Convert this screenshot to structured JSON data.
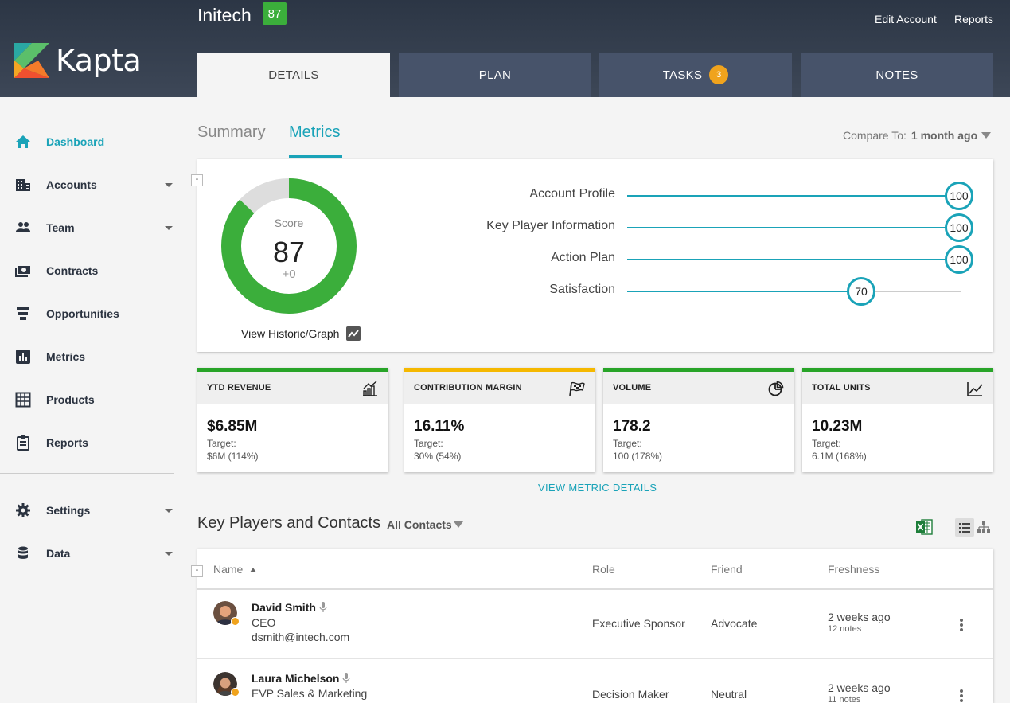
{
  "header": {
    "account_name": "Initech",
    "account_score": "87",
    "logo_text": "Kapta",
    "links": [
      "Edit Account",
      "Reports"
    ],
    "tabs": [
      {
        "label": "DETAILS",
        "badge": null
      },
      {
        "label": "PLAN",
        "badge": null
      },
      {
        "label": "TASKS",
        "badge": "3"
      },
      {
        "label": "NOTES",
        "badge": null
      }
    ],
    "active_tab": "DETAILS"
  },
  "sidebar": {
    "items": [
      {
        "label": "Dashboard",
        "icon": "home-icon",
        "active": true,
        "has_submenu": false
      },
      {
        "label": "Accounts",
        "icon": "building-icon",
        "active": false,
        "has_submenu": true
      },
      {
        "label": "Team",
        "icon": "people-icon",
        "active": false,
        "has_submenu": true
      },
      {
        "label": "Contracts",
        "icon": "money-icon",
        "active": false,
        "has_submenu": false
      },
      {
        "label": "Opportunities",
        "icon": "funnel-icon",
        "active": false,
        "has_submenu": false
      },
      {
        "label": "Metrics",
        "icon": "bar-chart-icon",
        "active": false,
        "has_submenu": false
      },
      {
        "label": "Products",
        "icon": "grid-icon",
        "active": false,
        "has_submenu": false
      },
      {
        "label": "Reports",
        "icon": "clipboard-icon",
        "active": false,
        "has_submenu": false
      },
      {
        "label": "Settings",
        "icon": "gear-icon",
        "active": false,
        "has_submenu": true
      },
      {
        "label": "Data",
        "icon": "database-icon",
        "active": false,
        "has_submenu": true
      }
    ]
  },
  "subtabs": {
    "items": [
      "Summary",
      "Metrics"
    ],
    "active": "Metrics",
    "compare_label": "Compare To:",
    "compare_value": "1 month ago"
  },
  "score_card": {
    "collapse_label": "-",
    "score_label": "Score",
    "score": "87",
    "score_value": 87,
    "delta": "+0",
    "view_historic": "View Historic/Graph",
    "colors": {
      "filled": "#3bae3b",
      "empty": "#dddddd"
    },
    "metrics": [
      {
        "label": "Account Profile",
        "value": "100",
        "fraction": 1.0
      },
      {
        "label": "Key Player Information",
        "value": "100",
        "fraction": 1.0
      },
      {
        "label": "Action Plan",
        "value": "100",
        "fraction": 1.0
      },
      {
        "label": "Satisfaction",
        "value": "70",
        "fraction": 0.7
      }
    ]
  },
  "kpis": [
    {
      "title": "YTD REVENUE",
      "value": "$6.85M",
      "target_label": "Target:",
      "target": "$6M (114%)",
      "color": "#28a428",
      "icon": "bar-growth-icon"
    },
    {
      "title": "CONTRIBUTION MARGIN",
      "value": "16.11%",
      "target_label": "Target:",
      "target": "30% (54%)",
      "color": "#f5b800",
      "icon": "flag-icon"
    },
    {
      "title": "VOLUME",
      "value": "178.2",
      "target_label": "Target:",
      "target": "100 (178%)",
      "color": "#28a428",
      "icon": "pie-icon"
    },
    {
      "title": "TOTAL UNITS",
      "value": "10.23M",
      "target_label": "Target:",
      "target": "6.1M (168%)",
      "color": "#28a428",
      "icon": "line-chart-icon"
    }
  ],
  "view_metric_details": "VIEW METRIC DETAILS",
  "key_players": {
    "title": "Key Players and Contacts",
    "filter": "All Contacts",
    "collapse_label": "-",
    "columns": [
      "Name",
      "Role",
      "Friend",
      "Freshness"
    ],
    "rows": [
      {
        "name": "David Smith",
        "title": "CEO",
        "email": "dsmith@intech.com",
        "role": "Executive Sponsor",
        "friend": "Advocate",
        "freshness": "2 weeks ago",
        "notes": "12 notes"
      },
      {
        "name": "Laura Michelson",
        "title": "EVP Sales & Marketing",
        "email": "",
        "role": "Decision Maker",
        "friend": "Neutral",
        "freshness": "2 weeks ago",
        "notes": "11 notes"
      }
    ]
  }
}
